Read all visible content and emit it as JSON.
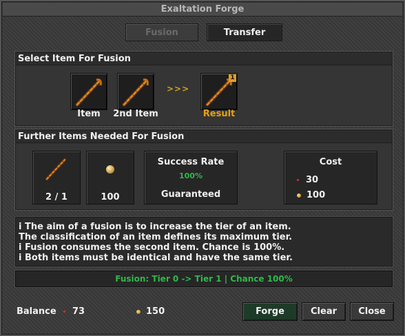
{
  "window": {
    "title": "Exaltation Forge"
  },
  "tabs": [
    {
      "label": "Fusion",
      "state": "disabled"
    },
    {
      "label": "Transfer",
      "state": "active"
    }
  ],
  "select_section": {
    "heading": "Select Item For Fusion",
    "slots": [
      {
        "label": "Item",
        "icon": "staff-icon"
      },
      {
        "label": "2nd Item",
        "icon": "staff-icon"
      },
      {
        "label": "Result",
        "icon": "staff-icon",
        "badge": "1"
      }
    ],
    "arrows": ">>>"
  },
  "further_section": {
    "heading": "Further Items Needed For Fusion",
    "item_count": "2 / 1",
    "gold_amount": "100",
    "success": {
      "title": "Success Rate",
      "percent": "100%",
      "status": "Guaranteed"
    },
    "cost": {
      "title": "Cost",
      "red": "30",
      "gold": "100"
    }
  },
  "info_lines": [
    "i  The aim of a fusion is to increase the tier of an item.",
    "The classification of an item defines its maximum tier.",
    "i  Fusion consumes the second item. Chance is 100%.",
    "i  Both items must be identical and have the same tier."
  ],
  "status": "Fusion: Tier 0 -> Tier 1 | Chance 100%",
  "balance": {
    "label": "Balance",
    "red": "73",
    "gold": "150"
  },
  "buttons": {
    "forge": "Forge",
    "clear": "Clear",
    "close": "Close"
  },
  "colors": {
    "accent_green": "#2fb84a",
    "result_orange": "#e8a010",
    "background": "#3a3a3a"
  }
}
